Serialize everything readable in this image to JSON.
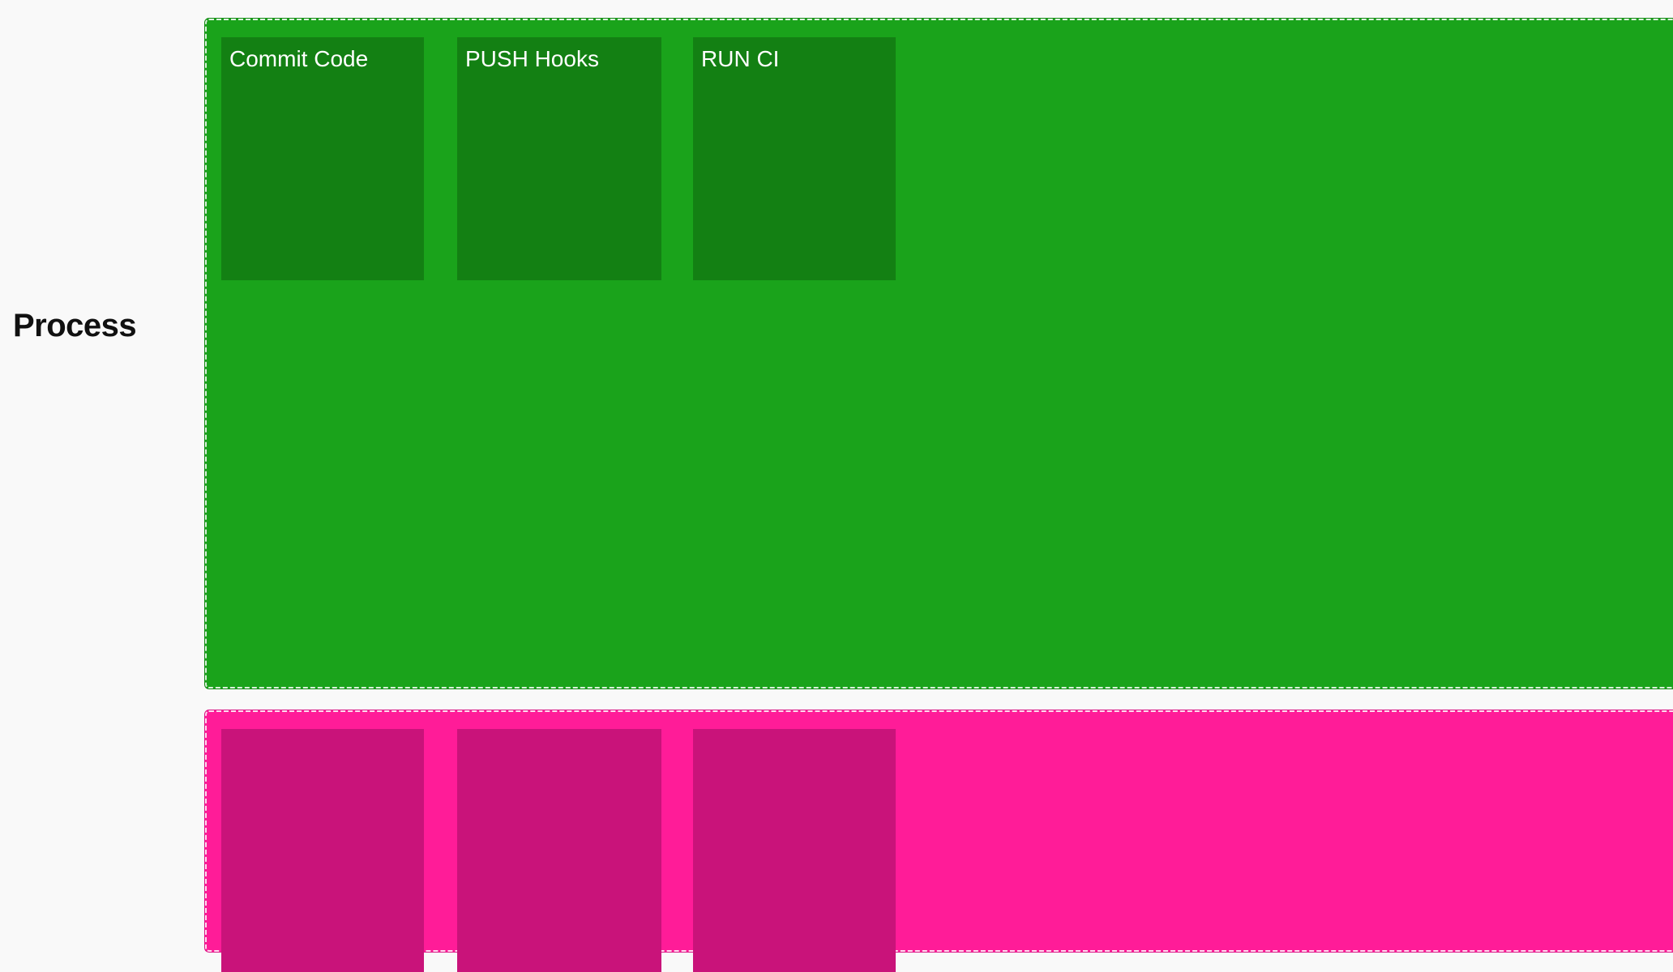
{
  "row_label": "Process",
  "lanes": [
    {
      "color": "#1aa31b",
      "cards": [
        {
          "label": "Commit Code"
        },
        {
          "label": "PUSH Hooks"
        },
        {
          "label": "RUN CI"
        }
      ]
    },
    {
      "color": "#ff1c98",
      "cards": [
        {
          "label": ""
        },
        {
          "label": ""
        },
        {
          "label": ""
        }
      ]
    }
  ]
}
